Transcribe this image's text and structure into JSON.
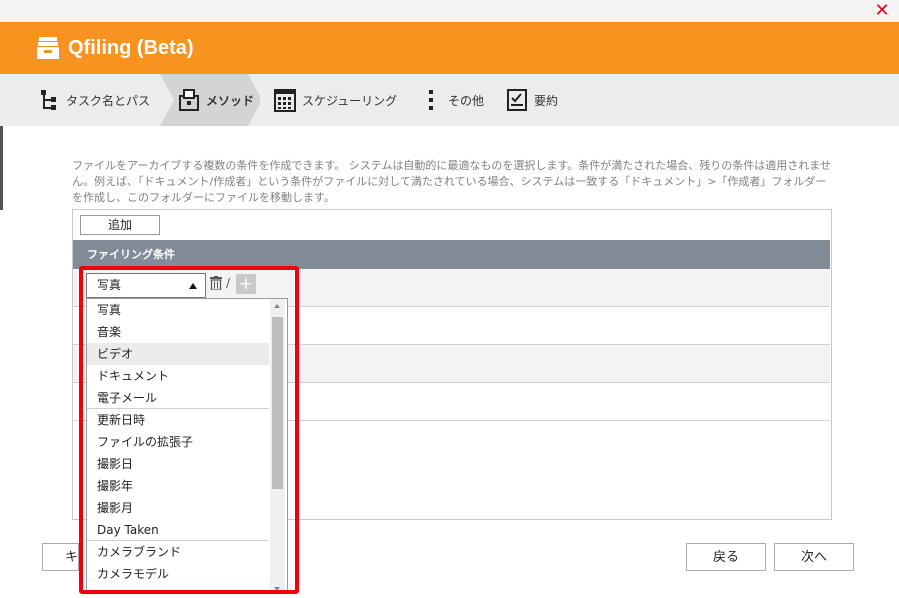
{
  "window": {
    "close_icon": "close-icon"
  },
  "header": {
    "title": "Qfiling (Beta)",
    "icon": "archive-box-icon",
    "bg_color": "#f7931e"
  },
  "steps": [
    {
      "label": "タスク名とパス",
      "icon": "tree-icon"
    },
    {
      "label": "メソッド",
      "icon": "method-icon",
      "active": true
    },
    {
      "label": "スケジューリング",
      "icon": "calendar-icon"
    },
    {
      "label": "その他",
      "icon": "more-vertical-icon"
    },
    {
      "label": "要約",
      "icon": "summary-icon"
    }
  ],
  "description": "ファイルをアーカイブする複数の条件を作成できます。 システムは自動的に最適なものを選択します。条件が満たされた場合、残りの条件は適用されません。例えば、「ドキュメント/作成者」という条件がファイルに対して満たされている場合、システムは一致する「ドキュメント」>「作成者」フォルダーを作成し、このフォルダーにファイルを移動します。",
  "panel": {
    "add_label": "追加",
    "table_header": "ファイリング条件",
    "select_value": "写真",
    "slash": "/",
    "plus": "+"
  },
  "dropdown": {
    "options": [
      "写真",
      "音楽",
      "ビデオ",
      "ドキュメント",
      "電子メール",
      "更新日時",
      "ファイルの拡張子",
      "撮影日",
      "撮影年",
      "撮影月",
      "Day Taken",
      "カメラブランド",
      "カメラモデル"
    ],
    "hovered_index": 2,
    "highlight_color": "#f2000a"
  },
  "footer": {
    "cancel_label": "キ",
    "back_label": "戻る",
    "next_label": "次へ"
  }
}
